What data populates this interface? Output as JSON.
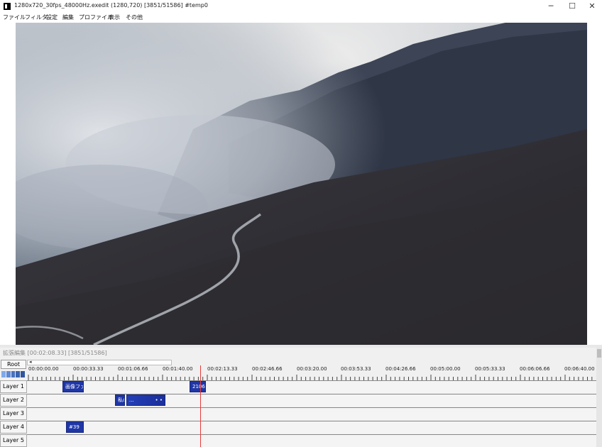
{
  "window": {
    "title": "1280x720_30fps_48000Hz.exedit (1280,720)  [3851/51586]  #temp0",
    "controls": {
      "minimize": "─",
      "maximize": "☐",
      "close": "✕"
    }
  },
  "menu": {
    "items": [
      "ファイル",
      "フィルタ",
      "設定",
      "編集",
      "プロファイル",
      "表示",
      "その他"
    ]
  },
  "preview": {
    "description_icon": "video-preview"
  },
  "timeline": {
    "title": "拡張編集 [00:02:08.33] [3851/51586]",
    "root_label": "Root",
    "scroll_arrow": "◂",
    "ruler_labels": [
      "00:00:00.00",
      "00:00:33.33",
      "00:01:06.66",
      "00:01:40.00",
      "00:02:13.33",
      "00:02:46.66",
      "00:03:20.00",
      "00:03:53.33",
      "00:04:26.66",
      "00:05:00.00",
      "00:05:33.33",
      "00:06:06.66",
      "00:06:40.00"
    ],
    "zoom_colors": [
      "#7fa9e8",
      "#5d89d4",
      "#4a73bd",
      "#3c64ad",
      "#2f559e"
    ],
    "layers": [
      {
        "label": "Layer 1"
      },
      {
        "label": "Layer 2"
      },
      {
        "label": "Layer 3"
      },
      {
        "label": "Layer 4"
      },
      {
        "label": "Layer 5"
      }
    ],
    "clips": {
      "layer1_clip1": "画像ファ",
      "layer1_clip2": "21060",
      "layer2_clip1": "私の",
      "layer2_clip2": "...",
      "layer2_clip2_handle": "• •",
      "layer4_clip1": "#39"
    }
  }
}
